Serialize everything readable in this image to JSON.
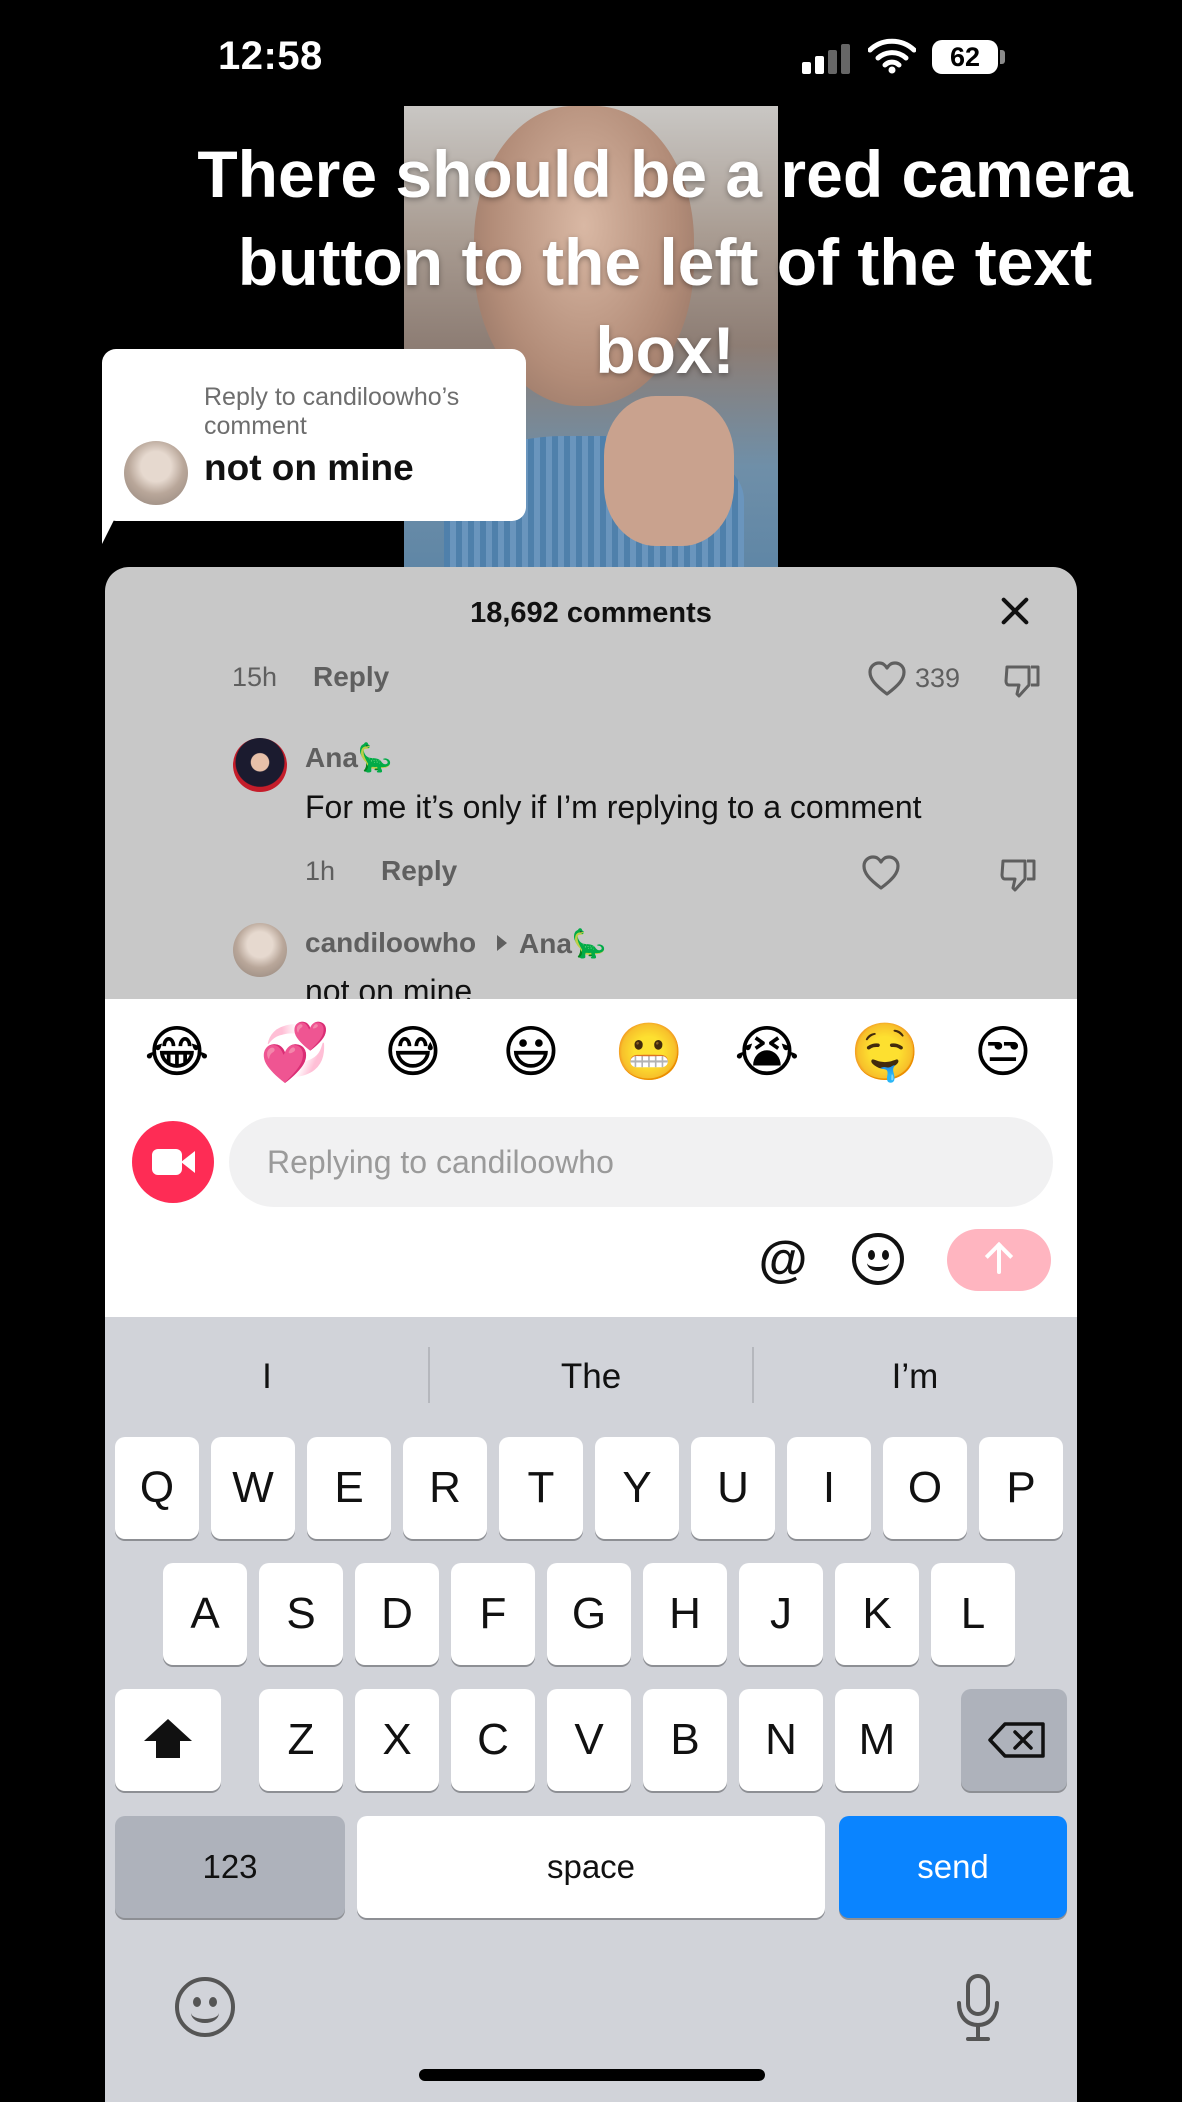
{
  "status": {
    "time": "12:58",
    "battery": "62"
  },
  "caption": "There should be a red camera button to the left of the text box!",
  "bubble": {
    "meta": "Reply to candiloowho’s comment",
    "text": "not on mine"
  },
  "sheet": {
    "title": "18,692 comments",
    "top_row": {
      "age": "15h",
      "reply": "Reply",
      "likes": "339"
    },
    "comments": [
      {
        "name": "Ana🦕",
        "text": "For me it’s only if I’m replying to a comment",
        "age": "1h",
        "reply": "Reply"
      },
      {
        "name": "candiloowho",
        "reply_to": "Ana🦕",
        "text": "not on mine"
      }
    ]
  },
  "composer": {
    "emojis": [
      "😂",
      "💞",
      "😅",
      "😃",
      "😬",
      "😭",
      "🤤",
      "😒"
    ],
    "placeholder": "Replying to candiloowho",
    "mention": "@"
  },
  "keyboard": {
    "suggestions": [
      "I",
      "The",
      "I’m"
    ],
    "row1": [
      "Q",
      "W",
      "E",
      "R",
      "T",
      "Y",
      "U",
      "I",
      "O",
      "P"
    ],
    "row2": [
      "A",
      "S",
      "D",
      "F",
      "G",
      "H",
      "J",
      "K",
      "L"
    ],
    "row3": [
      "Z",
      "X",
      "C",
      "V",
      "B",
      "N",
      "M"
    ],
    "numbers": "123",
    "space": "space",
    "send": "send"
  },
  "colors": {
    "record": "#fe2c55",
    "send_key": "#0a84ff",
    "send_pill": "#ffb5c0"
  },
  "icons": [
    "signal-icon",
    "wifi-icon",
    "close-icon",
    "heart-icon",
    "dislike-icon",
    "video-camera-icon",
    "at-icon",
    "smiley-icon",
    "arrow-up-icon",
    "shift-icon",
    "backspace-icon",
    "emoji-keyboard-icon",
    "microphone-icon"
  ]
}
